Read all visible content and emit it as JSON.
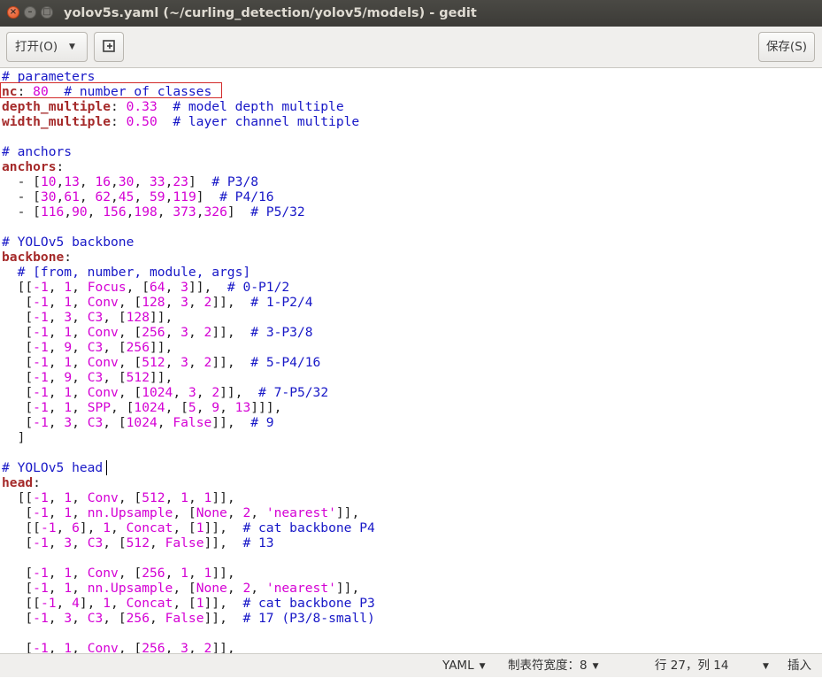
{
  "window": {
    "title": "yolov5s.yaml (~/curling_detection/yolov5/models) - gedit"
  },
  "toolbar": {
    "open_label": "打开(O)",
    "save_label": "保存(S)",
    "new_doc_icon": "new-document-icon"
  },
  "editor": {
    "lines": [
      [
        [
          "cm",
          "# parameters"
        ]
      ],
      [
        [
          "key",
          "nc"
        ],
        [
          "txt",
          ": "
        ],
        [
          "num",
          "80"
        ],
        [
          "txt",
          "  "
        ],
        [
          "cm",
          "# number of classes"
        ]
      ],
      [
        [
          "key",
          "depth_multiple"
        ],
        [
          "txt",
          ": "
        ],
        [
          "num",
          "0.33"
        ],
        [
          "txt",
          "  "
        ],
        [
          "cm",
          "# model depth multiple"
        ]
      ],
      [
        [
          "key",
          "width_multiple"
        ],
        [
          "txt",
          ": "
        ],
        [
          "num",
          "0.50"
        ],
        [
          "txt",
          "  "
        ],
        [
          "cm",
          "# layer channel multiple"
        ]
      ],
      [],
      [
        [
          "cm",
          "# anchors"
        ]
      ],
      [
        [
          "key",
          "anchors"
        ],
        [
          "txt",
          ":"
        ]
      ],
      [
        [
          "txt",
          "  - ["
        ],
        [
          "num",
          "10"
        ],
        [
          "txt",
          ","
        ],
        [
          "num",
          "13"
        ],
        [
          "txt",
          ", "
        ],
        [
          "num",
          "16"
        ],
        [
          "txt",
          ","
        ],
        [
          "num",
          "30"
        ],
        [
          "txt",
          ", "
        ],
        [
          "num",
          "33"
        ],
        [
          "txt",
          ","
        ],
        [
          "num",
          "23"
        ],
        [
          "txt",
          "]  "
        ],
        [
          "cm",
          "# P3/8"
        ]
      ],
      [
        [
          "txt",
          "  - ["
        ],
        [
          "num",
          "30"
        ],
        [
          "txt",
          ","
        ],
        [
          "num",
          "61"
        ],
        [
          "txt",
          ", "
        ],
        [
          "num",
          "62"
        ],
        [
          "txt",
          ","
        ],
        [
          "num",
          "45"
        ],
        [
          "txt",
          ", "
        ],
        [
          "num",
          "59"
        ],
        [
          "txt",
          ","
        ],
        [
          "num",
          "119"
        ],
        [
          "txt",
          "]  "
        ],
        [
          "cm",
          "# P4/16"
        ]
      ],
      [
        [
          "txt",
          "  - ["
        ],
        [
          "num",
          "116"
        ],
        [
          "txt",
          ","
        ],
        [
          "num",
          "90"
        ],
        [
          "txt",
          ", "
        ],
        [
          "num",
          "156"
        ],
        [
          "txt",
          ","
        ],
        [
          "num",
          "198"
        ],
        [
          "txt",
          ", "
        ],
        [
          "num",
          "373"
        ],
        [
          "txt",
          ","
        ],
        [
          "num",
          "326"
        ],
        [
          "txt",
          "]  "
        ],
        [
          "cm",
          "# P5/32"
        ]
      ],
      [],
      [
        [
          "cm",
          "# YOLOv5 backbone"
        ]
      ],
      [
        [
          "key",
          "backbone"
        ],
        [
          "txt",
          ":"
        ]
      ],
      [
        [
          "txt",
          "  "
        ],
        [
          "cm",
          "# [from, number, module, args]"
        ]
      ],
      [
        [
          "txt",
          "  [["
        ],
        [
          "num",
          "-1"
        ],
        [
          "txt",
          ", "
        ],
        [
          "num",
          "1"
        ],
        [
          "txt",
          ", "
        ],
        [
          "str",
          "Focus"
        ],
        [
          "txt",
          ", ["
        ],
        [
          "num",
          "64"
        ],
        [
          "txt",
          ", "
        ],
        [
          "num",
          "3"
        ],
        [
          "txt",
          "]],  "
        ],
        [
          "cm",
          "# 0-P1/2"
        ]
      ],
      [
        [
          "txt",
          "   ["
        ],
        [
          "num",
          "-1"
        ],
        [
          "txt",
          ", "
        ],
        [
          "num",
          "1"
        ],
        [
          "txt",
          ", "
        ],
        [
          "str",
          "Conv"
        ],
        [
          "txt",
          ", ["
        ],
        [
          "num",
          "128"
        ],
        [
          "txt",
          ", "
        ],
        [
          "num",
          "3"
        ],
        [
          "txt",
          ", "
        ],
        [
          "num",
          "2"
        ],
        [
          "txt",
          "]],  "
        ],
        [
          "cm",
          "# 1-P2/4"
        ]
      ],
      [
        [
          "txt",
          "   ["
        ],
        [
          "num",
          "-1"
        ],
        [
          "txt",
          ", "
        ],
        [
          "num",
          "3"
        ],
        [
          "txt",
          ", "
        ],
        [
          "str",
          "C3"
        ],
        [
          "txt",
          ", ["
        ],
        [
          "num",
          "128"
        ],
        [
          "txt",
          "]],"
        ]
      ],
      [
        [
          "txt",
          "   ["
        ],
        [
          "num",
          "-1"
        ],
        [
          "txt",
          ", "
        ],
        [
          "num",
          "1"
        ],
        [
          "txt",
          ", "
        ],
        [
          "str",
          "Conv"
        ],
        [
          "txt",
          ", ["
        ],
        [
          "num",
          "256"
        ],
        [
          "txt",
          ", "
        ],
        [
          "num",
          "3"
        ],
        [
          "txt",
          ", "
        ],
        [
          "num",
          "2"
        ],
        [
          "txt",
          "]],  "
        ],
        [
          "cm",
          "# 3-P3/8"
        ]
      ],
      [
        [
          "txt",
          "   ["
        ],
        [
          "num",
          "-1"
        ],
        [
          "txt",
          ", "
        ],
        [
          "num",
          "9"
        ],
        [
          "txt",
          ", "
        ],
        [
          "str",
          "C3"
        ],
        [
          "txt",
          ", ["
        ],
        [
          "num",
          "256"
        ],
        [
          "txt",
          "]],"
        ]
      ],
      [
        [
          "txt",
          "   ["
        ],
        [
          "num",
          "-1"
        ],
        [
          "txt",
          ", "
        ],
        [
          "num",
          "1"
        ],
        [
          "txt",
          ", "
        ],
        [
          "str",
          "Conv"
        ],
        [
          "txt",
          ", ["
        ],
        [
          "num",
          "512"
        ],
        [
          "txt",
          ", "
        ],
        [
          "num",
          "3"
        ],
        [
          "txt",
          ", "
        ],
        [
          "num",
          "2"
        ],
        [
          "txt",
          "]],  "
        ],
        [
          "cm",
          "# 5-P4/16"
        ]
      ],
      [
        [
          "txt",
          "   ["
        ],
        [
          "num",
          "-1"
        ],
        [
          "txt",
          ", "
        ],
        [
          "num",
          "9"
        ],
        [
          "txt",
          ", "
        ],
        [
          "str",
          "C3"
        ],
        [
          "txt",
          ", ["
        ],
        [
          "num",
          "512"
        ],
        [
          "txt",
          "]],"
        ]
      ],
      [
        [
          "txt",
          "   ["
        ],
        [
          "num",
          "-1"
        ],
        [
          "txt",
          ", "
        ],
        [
          "num",
          "1"
        ],
        [
          "txt",
          ", "
        ],
        [
          "str",
          "Conv"
        ],
        [
          "txt",
          ", ["
        ],
        [
          "num",
          "1024"
        ],
        [
          "txt",
          ", "
        ],
        [
          "num",
          "3"
        ],
        [
          "txt",
          ", "
        ],
        [
          "num",
          "2"
        ],
        [
          "txt",
          "]],  "
        ],
        [
          "cm",
          "# 7-P5/32"
        ]
      ],
      [
        [
          "txt",
          "   ["
        ],
        [
          "num",
          "-1"
        ],
        [
          "txt",
          ", "
        ],
        [
          "num",
          "1"
        ],
        [
          "txt",
          ", "
        ],
        [
          "str",
          "SPP"
        ],
        [
          "txt",
          ", ["
        ],
        [
          "num",
          "1024"
        ],
        [
          "txt",
          ", ["
        ],
        [
          "num",
          "5"
        ],
        [
          "txt",
          ", "
        ],
        [
          "num",
          "9"
        ],
        [
          "txt",
          ", "
        ],
        [
          "num",
          "13"
        ],
        [
          "txt",
          "]]],"
        ]
      ],
      [
        [
          "txt",
          "   ["
        ],
        [
          "num",
          "-1"
        ],
        [
          "txt",
          ", "
        ],
        [
          "num",
          "3"
        ],
        [
          "txt",
          ", "
        ],
        [
          "str",
          "C3"
        ],
        [
          "txt",
          ", ["
        ],
        [
          "num",
          "1024"
        ],
        [
          "txt",
          ", "
        ],
        [
          "str",
          "False"
        ],
        [
          "txt",
          "]],  "
        ],
        [
          "cm",
          "# 9"
        ]
      ],
      [
        [
          "txt",
          "  ]"
        ]
      ],
      [],
      [
        [
          "cm",
          "# YOLOv5 head"
        ]
      ],
      [
        [
          "key",
          "head"
        ],
        [
          "txt",
          ":"
        ]
      ],
      [
        [
          "txt",
          "  [["
        ],
        [
          "num",
          "-1"
        ],
        [
          "txt",
          ", "
        ],
        [
          "num",
          "1"
        ],
        [
          "txt",
          ", "
        ],
        [
          "str",
          "Conv"
        ],
        [
          "txt",
          ", ["
        ],
        [
          "num",
          "512"
        ],
        [
          "txt",
          ", "
        ],
        [
          "num",
          "1"
        ],
        [
          "txt",
          ", "
        ],
        [
          "num",
          "1"
        ],
        [
          "txt",
          "]],"
        ]
      ],
      [
        [
          "txt",
          "   ["
        ],
        [
          "num",
          "-1"
        ],
        [
          "txt",
          ", "
        ],
        [
          "num",
          "1"
        ],
        [
          "txt",
          ", "
        ],
        [
          "str",
          "nn.Upsample"
        ],
        [
          "txt",
          ", ["
        ],
        [
          "str",
          "None"
        ],
        [
          "txt",
          ", "
        ],
        [
          "num",
          "2"
        ],
        [
          "txt",
          ", "
        ],
        [
          "str",
          "'nearest'"
        ],
        [
          "txt",
          "]],"
        ]
      ],
      [
        [
          "txt",
          "   [["
        ],
        [
          "num",
          "-1"
        ],
        [
          "txt",
          ", "
        ],
        [
          "num",
          "6"
        ],
        [
          "txt",
          "], "
        ],
        [
          "num",
          "1"
        ],
        [
          "txt",
          ", "
        ],
        [
          "str",
          "Concat"
        ],
        [
          "txt",
          ", ["
        ],
        [
          "num",
          "1"
        ],
        [
          "txt",
          "]],  "
        ],
        [
          "cm",
          "# cat backbone P4"
        ]
      ],
      [
        [
          "txt",
          "   ["
        ],
        [
          "num",
          "-1"
        ],
        [
          "txt",
          ", "
        ],
        [
          "num",
          "3"
        ],
        [
          "txt",
          ", "
        ],
        [
          "str",
          "C3"
        ],
        [
          "txt",
          ", ["
        ],
        [
          "num",
          "512"
        ],
        [
          "txt",
          ", "
        ],
        [
          "str",
          "False"
        ],
        [
          "txt",
          "]],  "
        ],
        [
          "cm",
          "# 13"
        ]
      ],
      [],
      [
        [
          "txt",
          "   ["
        ],
        [
          "num",
          "-1"
        ],
        [
          "txt",
          ", "
        ],
        [
          "num",
          "1"
        ],
        [
          "txt",
          ", "
        ],
        [
          "str",
          "Conv"
        ],
        [
          "txt",
          ", ["
        ],
        [
          "num",
          "256"
        ],
        [
          "txt",
          ", "
        ],
        [
          "num",
          "1"
        ],
        [
          "txt",
          ", "
        ],
        [
          "num",
          "1"
        ],
        [
          "txt",
          "]],"
        ]
      ],
      [
        [
          "txt",
          "   ["
        ],
        [
          "num",
          "-1"
        ],
        [
          "txt",
          ", "
        ],
        [
          "num",
          "1"
        ],
        [
          "txt",
          ", "
        ],
        [
          "str",
          "nn.Upsample"
        ],
        [
          "txt",
          ", ["
        ],
        [
          "str",
          "None"
        ],
        [
          "txt",
          ", "
        ],
        [
          "num",
          "2"
        ],
        [
          "txt",
          ", "
        ],
        [
          "str",
          "'nearest'"
        ],
        [
          "txt",
          "]],"
        ]
      ],
      [
        [
          "txt",
          "   [["
        ],
        [
          "num",
          "-1"
        ],
        [
          "txt",
          ", "
        ],
        [
          "num",
          "4"
        ],
        [
          "txt",
          "], "
        ],
        [
          "num",
          "1"
        ],
        [
          "txt",
          ", "
        ],
        [
          "str",
          "Concat"
        ],
        [
          "txt",
          ", ["
        ],
        [
          "num",
          "1"
        ],
        [
          "txt",
          "]],  "
        ],
        [
          "cm",
          "# cat backbone P3"
        ]
      ],
      [
        [
          "txt",
          "   ["
        ],
        [
          "num",
          "-1"
        ],
        [
          "txt",
          ", "
        ],
        [
          "num",
          "3"
        ],
        [
          "txt",
          ", "
        ],
        [
          "str",
          "C3"
        ],
        [
          "txt",
          ", ["
        ],
        [
          "num",
          "256"
        ],
        [
          "txt",
          ", "
        ],
        [
          "str",
          "False"
        ],
        [
          "txt",
          "]],  "
        ],
        [
          "cm",
          "# 17 (P3/8-small)"
        ]
      ],
      [],
      [
        [
          "txt",
          "   ["
        ],
        [
          "num",
          "-1"
        ],
        [
          "txt",
          ", "
        ],
        [
          "num",
          "1"
        ],
        [
          "txt",
          ", "
        ],
        [
          "str",
          "Conv"
        ],
        [
          "txt",
          ", ["
        ],
        [
          "num",
          "256"
        ],
        [
          "txt",
          ", "
        ],
        [
          "num",
          "3"
        ],
        [
          "txt",
          ", "
        ],
        [
          "num",
          "2"
        ],
        [
          "txt",
          "]],"
        ]
      ]
    ]
  },
  "statusbar": {
    "language": "YAML",
    "tab_width": "制表符宽度：8",
    "position": "行 27，列 14",
    "insert_mode": "插入"
  }
}
